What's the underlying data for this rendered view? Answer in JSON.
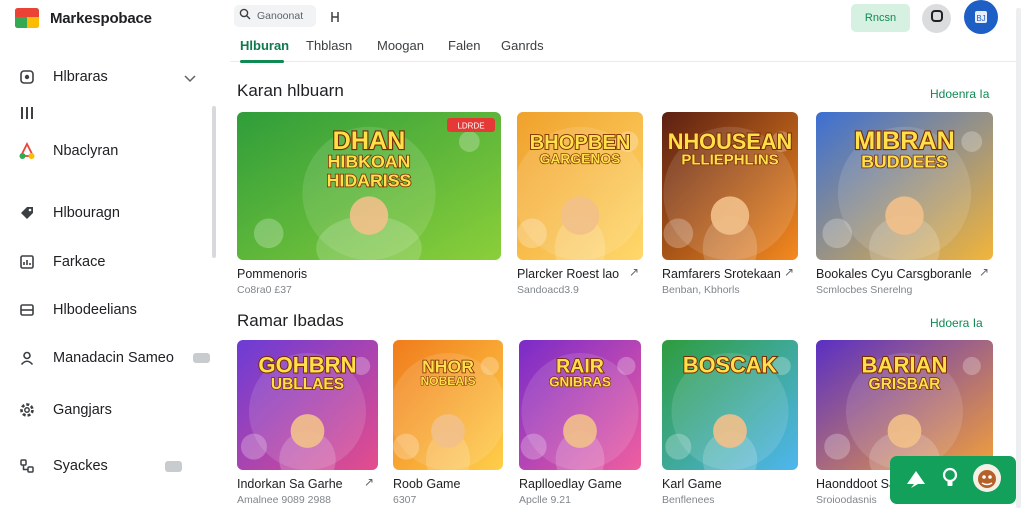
{
  "app": {
    "name": "Markespobace"
  },
  "search": {
    "placeholder": "Ganoonat"
  },
  "toolbar": {
    "signin_label": "Rncsn",
    "user_initials": "BJ"
  },
  "sidebar": {
    "items": [
      {
        "label": "Hlbraras",
        "icon": "home-icon"
      },
      {
        "label": "",
        "icon": "library-icon"
      },
      {
        "label": "Nbaclyran",
        "icon": "apps-icon"
      },
      {
        "label": "Hlbouragn",
        "icon": "tag-icon"
      },
      {
        "label": "Farkace",
        "icon": "grid-icon"
      },
      {
        "label": "Hlbodeelians",
        "icon": "list-icon"
      },
      {
        "label": "Manadacin Sameo",
        "icon": "person-icon"
      },
      {
        "label": "Gangjars",
        "icon": "gear-icon"
      },
      {
        "label": "Syackes",
        "icon": "puzzle-icon"
      }
    ]
  },
  "tabs": [
    "Hlburan",
    "Thblasn",
    "Moogan",
    "Falen",
    "Ganrds"
  ],
  "sections": [
    {
      "title": "Karan hlbuarn",
      "link": "Hdoenra Ia",
      "cards": [
        {
          "title": "Pommenoris",
          "subtitle": "Co8ra0 £37",
          "art_text": [
            "DHAN",
            "HIBKOAN",
            "HIDARISS"
          ],
          "badge": "LDRDE",
          "colors": [
            "#2f9d3a",
            "#8bcf3a"
          ]
        },
        {
          "title": "Plarcker Roest lao",
          "subtitle": "Sandoacd3.9",
          "art_text": [
            "BHOPBEN",
            "GARGENOS"
          ],
          "badge": "",
          "colors": [
            "#f0a12c",
            "#ffd86b"
          ]
        },
        {
          "title": "Ramfarers Srotekaan",
          "subtitle": "Benban, Kbhorls",
          "art_text": [
            "NHOUSEAN",
            "PLLIEPHLINS"
          ],
          "badge": "",
          "colors": [
            "#5b1f12",
            "#f58a1f"
          ]
        },
        {
          "title": "Bookales Cyu Carsgboranle",
          "subtitle": "Scmlocbes Snerelng",
          "art_text": [
            "MIBRAN",
            "BUDDEES"
          ],
          "badge": "",
          "colors": [
            "#3b6fd4",
            "#f2b53a"
          ]
        }
      ]
    },
    {
      "title": "Ramar Ibadas",
      "link": "Hdoera Ia",
      "cards": [
        {
          "title": "Indorkan Sa Garhe",
          "subtitle": "Amalnee 9089 2988",
          "art_text": [
            "GOHBRN",
            "UBLLAES"
          ],
          "badge": "",
          "colors": [
            "#6b3bd6",
            "#e54d8c"
          ]
        },
        {
          "title": "Roob Game",
          "subtitle": "6307",
          "art_text": [
            "NHOR",
            "NOBEAIS"
          ],
          "badge": "",
          "colors": [
            "#f07c1c",
            "#ffcf4a"
          ]
        },
        {
          "title": "Raplloedlay Game",
          "subtitle": "Apclle 9.21",
          "art_text": [
            "RAIR",
            "GNIBRAS"
          ],
          "badge": "",
          "colors": [
            "#7a2bc9",
            "#f05fa0"
          ]
        },
        {
          "title": "Karl Game",
          "subtitle": "Benflenees",
          "art_text": [
            "BOSCAK"
          ],
          "badge": "",
          "colors": [
            "#2e9c3d",
            "#4fb6f0"
          ]
        },
        {
          "title": "Haonddoot Sa",
          "subtitle": "Sroioodasnis",
          "art_text": [
            "BARIAN",
            "GRISBAR"
          ],
          "badge": "",
          "colors": [
            "#5a2fc4",
            "#f2a13a"
          ]
        }
      ]
    }
  ]
}
